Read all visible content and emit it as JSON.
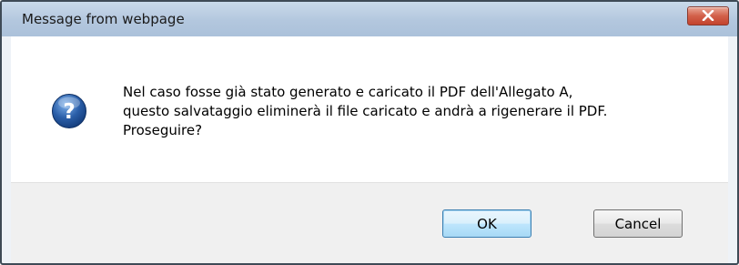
{
  "dialog": {
    "title": "Message from webpage",
    "close_label": "Close",
    "icon": "question-icon",
    "message_lines": [
      "Nel caso fosse già stato generato e caricato il PDF dell'Allegato A,",
      "questo salvataggio eliminerà il file caricato e andrà a rigenerare il PDF.",
      "Proseguire?"
    ],
    "buttons": {
      "ok_label": "OK",
      "cancel_label": "Cancel"
    }
  },
  "colors": {
    "titlebar": "#b3c7de",
    "close_button": "#c3432d",
    "icon_blue": "#2a5ea8",
    "button_bar": "#f0f0f0"
  }
}
